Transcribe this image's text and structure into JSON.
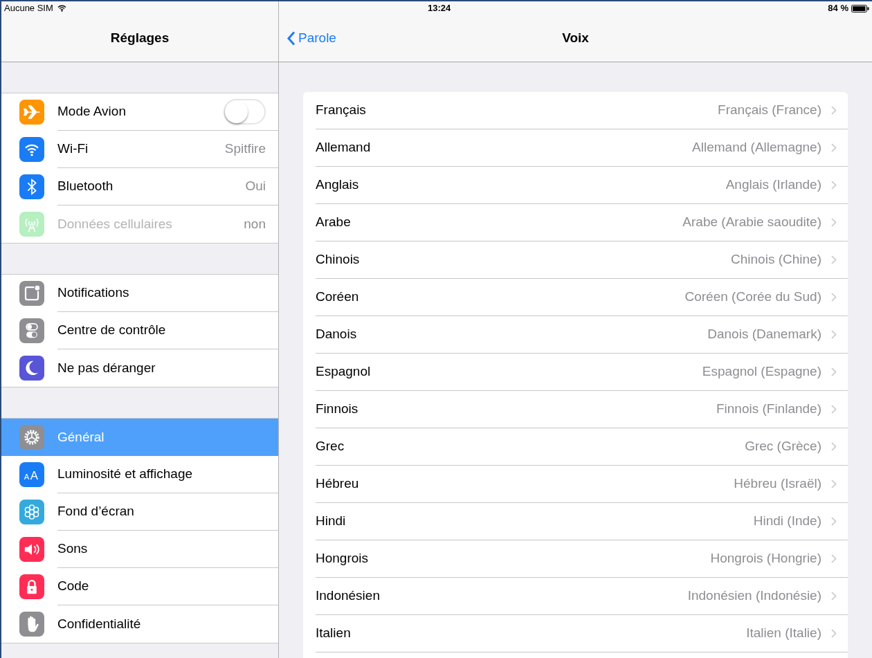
{
  "status_bar": {
    "carrier": "Aucune SIM",
    "time": "13:24",
    "battery": "84 %"
  },
  "sidebar": {
    "title": "Réglages",
    "groups": [
      {
        "items": [
          {
            "label": "Mode Avion",
            "kind": "toggle",
            "on": false,
            "disabled": false,
            "selected": false
          },
          {
            "label": "Wi-Fi",
            "kind": "value",
            "value": "Spitfire",
            "disabled": false,
            "selected": false
          },
          {
            "label": "Bluetooth",
            "kind": "value",
            "value": "Oui",
            "disabled": false,
            "selected": false
          },
          {
            "label": "Données cellulaires",
            "kind": "value",
            "value": "non",
            "disabled": true,
            "selected": false
          }
        ]
      },
      {
        "items": [
          {
            "label": "Notifications",
            "kind": "link",
            "disabled": false,
            "selected": false
          },
          {
            "label": "Centre de contrôle",
            "kind": "link",
            "disabled": false,
            "selected": false
          },
          {
            "label": "Ne pas déranger",
            "kind": "link",
            "disabled": false,
            "selected": false
          }
        ]
      },
      {
        "items": [
          {
            "label": "Général",
            "kind": "link",
            "disabled": false,
            "selected": true
          },
          {
            "label": "Luminosité et affichage",
            "kind": "link",
            "icon_glyphs": [
              "A",
              "A"
            ],
            "disabled": false,
            "selected": false
          },
          {
            "label": "Fond d’écran",
            "kind": "link",
            "disabled": false,
            "selected": false
          },
          {
            "label": "Sons",
            "kind": "link",
            "disabled": false,
            "selected": false
          },
          {
            "label": "Code",
            "kind": "link",
            "disabled": false,
            "selected": false
          },
          {
            "label": "Confidentialité",
            "kind": "link",
            "disabled": false,
            "selected": false
          }
        ]
      }
    ]
  },
  "detail": {
    "back": "Parole",
    "title": "Voix",
    "rows": [
      {
        "label": "Français",
        "value": "Français (France)"
      },
      {
        "label": "Allemand",
        "value": "Allemand (Allemagne)"
      },
      {
        "label": "Anglais",
        "value": "Anglais (Irlande)"
      },
      {
        "label": "Arabe",
        "value": "Arabe (Arabie saoudite)"
      },
      {
        "label": "Chinois",
        "value": "Chinois (Chine)"
      },
      {
        "label": "Coréen",
        "value": "Coréen (Corée du Sud)"
      },
      {
        "label": "Danois",
        "value": "Danois (Danemark)"
      },
      {
        "label": "Espagnol",
        "value": "Espagnol (Espagne)"
      },
      {
        "label": "Finnois",
        "value": "Finnois (Finlande)"
      },
      {
        "label": "Grec",
        "value": "Grec (Grèce)"
      },
      {
        "label": "Hébreu",
        "value": "Hébreu (Israël)"
      },
      {
        "label": "Hindi",
        "value": "Hindi (Inde)"
      },
      {
        "label": "Hongrois",
        "value": "Hongrois (Hongrie)"
      },
      {
        "label": "Indonésien",
        "value": "Indonésien (Indonésie)"
      },
      {
        "label": "Italien",
        "value": "Italien (Italie)"
      }
    ]
  }
}
